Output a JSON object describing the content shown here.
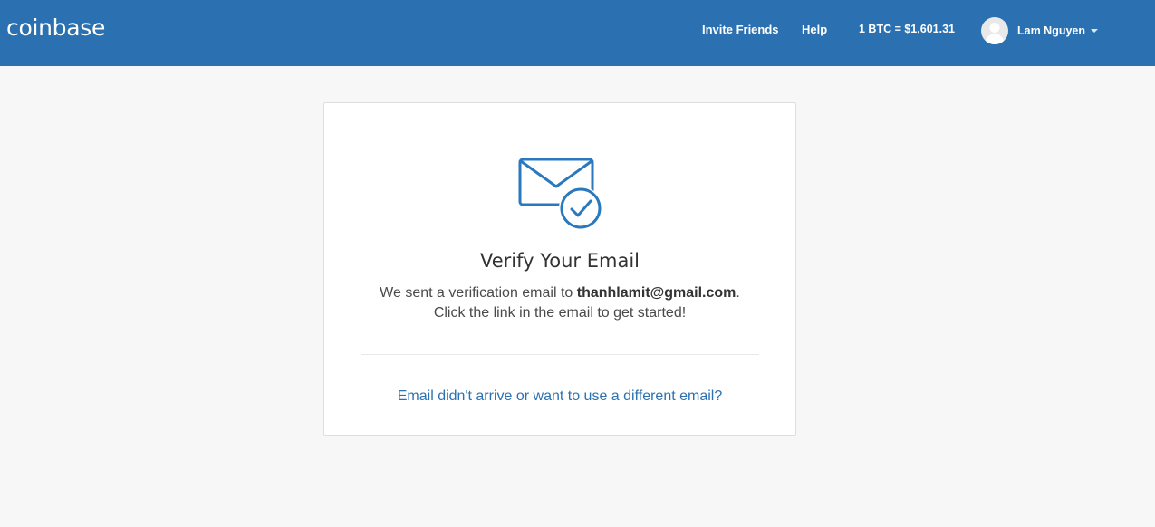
{
  "header": {
    "logo_text": "coinbase",
    "nav": {
      "invite_friends": "Invite Friends",
      "help": "Help"
    },
    "btc_price": "1 BTC = $1,601.31",
    "user": {
      "name": "Lam Nguyen",
      "avatar_icon": "user-avatar-icon",
      "menu_icon": "caret-down-icon"
    }
  },
  "verify_card": {
    "icon": "mail-check-icon",
    "title": "Verify Your Email",
    "message_prefix": "We sent a verification email to ",
    "email": "thanhlamit@gmail.com",
    "message_suffix": ".",
    "message_line2": "Click the link in the email to get started!",
    "resend_link": "Email didn't arrive or want to use a different email?"
  },
  "colors": {
    "brand_blue": "#2b71b1",
    "page_background": "#f7f7f7",
    "card_background": "#ffffff",
    "icon_blue": "#2a79be"
  }
}
